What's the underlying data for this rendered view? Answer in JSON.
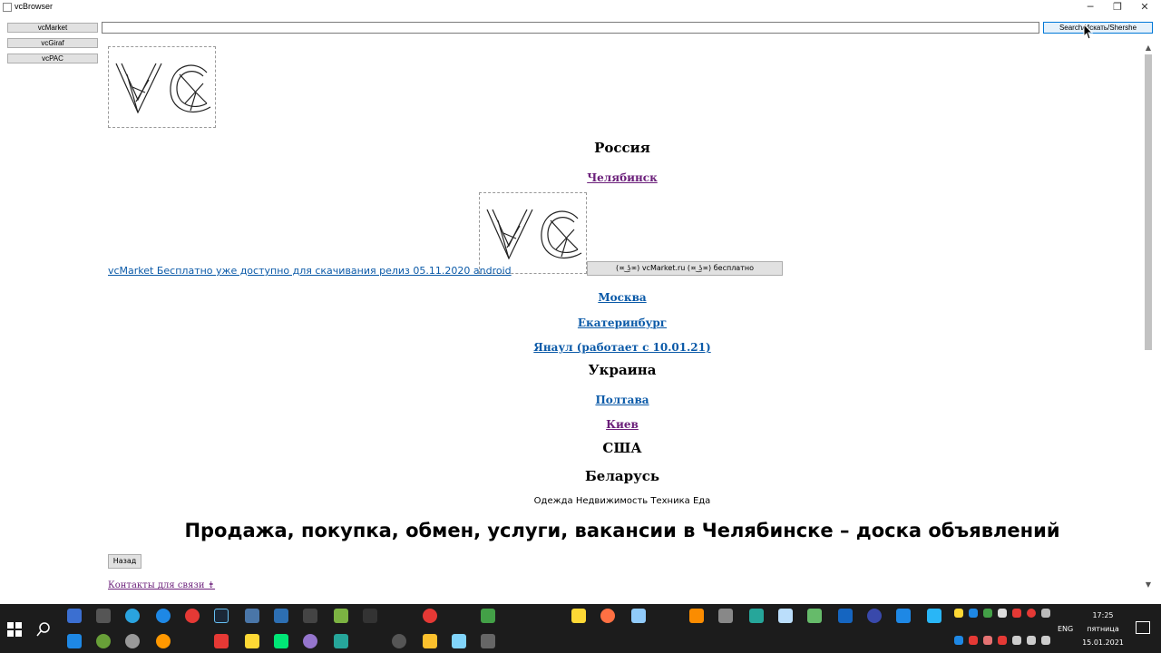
{
  "window": {
    "title": "vcBrowser"
  },
  "left_panel": {
    "buttons": [
      "vcMarket",
      "vcGiraf",
      "vcPAC"
    ]
  },
  "address_bar": {
    "value": "",
    "search_label": "Search/Искать/Shershe"
  },
  "content": {
    "russia": "Россия",
    "chelyabinsk": "Челябинск",
    "release_link": "vcMarket Бесплатно уже доступно для скачивания релиз 05.11.2020 android",
    "vcmarket_button": "(≖ ͜ʖ≖) vcMarket.ru (≖ ͜ʖ≖) бесплатно",
    "moscow": "Москва",
    "ekaterinburg": "Екатеринбург",
    "yanaul": "Янаул (работает с 10.01.21)",
    "ukraine": "Украина",
    "poltava": "Полтава",
    "kiev": "Киев",
    "usa": "США",
    "belarus": "Беларусь",
    "categories": "Одежда Недвижимость Техника Еда",
    "headline": "Продажа, покупка, обмен, услуги, вакансии в Челябинске – доска объявлений",
    "back_button": "Назад",
    "contacts_link": "Контакты для связи ⇟"
  },
  "taskbar": {
    "lang": "ENG",
    "time": "17:25",
    "day": "пятница",
    "date": "15.01.2021"
  }
}
